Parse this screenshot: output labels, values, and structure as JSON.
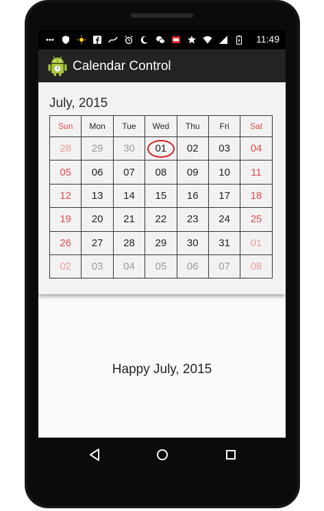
{
  "status": {
    "time": "11:49",
    "icons": [
      "cellular-icon",
      "shield-icon",
      "sun-icon",
      "facebook-icon",
      "swirl-icon",
      "alarm-icon",
      "moon-icon",
      "wechat-icon",
      "badge-icon",
      "star-icon",
      "wifi-icon",
      "signal-icon",
      "battery-icon"
    ]
  },
  "app": {
    "title": "Calendar Control"
  },
  "calendar": {
    "month_label": "July, 2015",
    "weekdays": [
      "Sun",
      "Mon",
      "Tue",
      "Wed",
      "Thu",
      "Fri",
      "Sat"
    ],
    "weeks": [
      [
        "28",
        "29",
        "30",
        "01",
        "02",
        "03",
        "04"
      ],
      [
        "05",
        "06",
        "07",
        "08",
        "09",
        "10",
        "11"
      ],
      [
        "12",
        "13",
        "14",
        "15",
        "16",
        "17",
        "18"
      ],
      [
        "19",
        "20",
        "21",
        "22",
        "23",
        "24",
        "25"
      ],
      [
        "26",
        "27",
        "28",
        "29",
        "30",
        "31",
        "01"
      ],
      [
        "02",
        "03",
        "04",
        "05",
        "06",
        "07",
        "08"
      ]
    ],
    "selected_day": "01"
  },
  "message": "Happy July, 2015",
  "colors": {
    "weekend": "#e24a4a",
    "today_ring": "#d71f1f",
    "action_bar": "#232323"
  }
}
